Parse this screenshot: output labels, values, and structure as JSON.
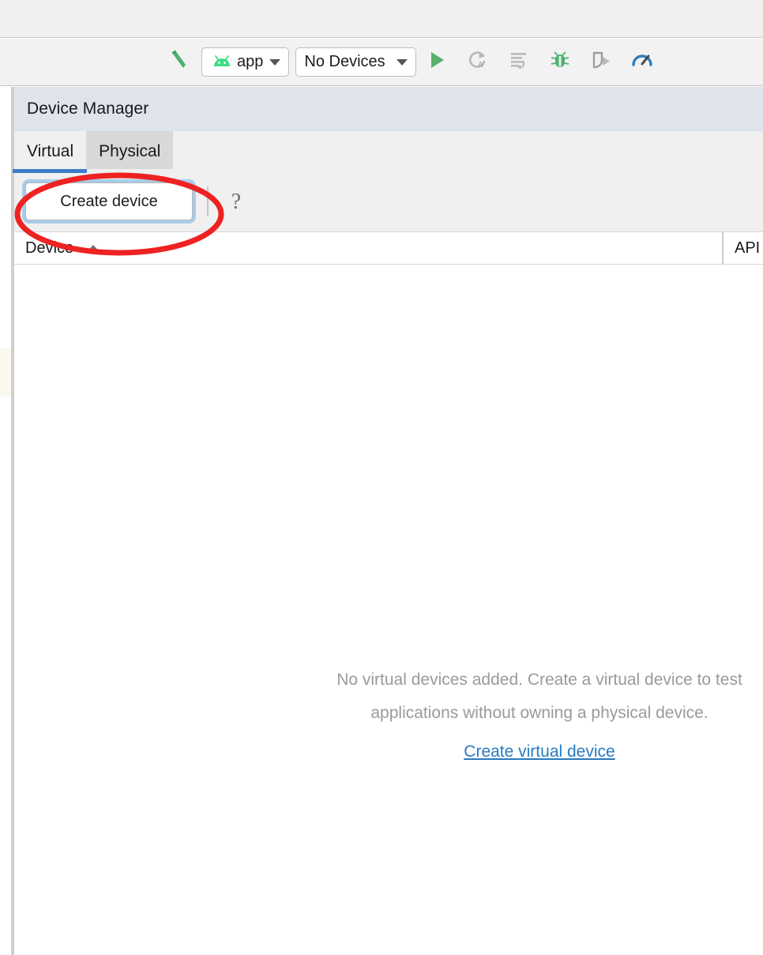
{
  "toolbar": {
    "build_icon": "hammer-build-icon",
    "run_config": {
      "icon": "android-robot-icon",
      "label": "app",
      "caret": "chevron-down-icon"
    },
    "device_selector": {
      "label": "No Devices",
      "caret": "chevron-down-icon"
    },
    "actions": [
      {
        "name": "run-button",
        "icon": "play-triangle-icon",
        "enabled": true
      },
      {
        "name": "apply-changes-button",
        "icon": "apply-changes-icon",
        "enabled": false
      },
      {
        "name": "apply-code-changes-button",
        "icon": "apply-code-changes-icon",
        "enabled": false
      },
      {
        "name": "debug-button",
        "icon": "bug-icon",
        "enabled": true
      },
      {
        "name": "run-with-coverage-button",
        "icon": "shield-run-icon",
        "enabled": false
      },
      {
        "name": "profiler-button",
        "icon": "profiler-gauge-icon",
        "enabled": true
      }
    ]
  },
  "tool_window": {
    "title": "Device Manager",
    "tabs": [
      {
        "label": "Virtual",
        "selected": true
      },
      {
        "label": "Physical",
        "selected": false,
        "hovered": true
      }
    ],
    "actions": {
      "create_device_label": "Create device",
      "help_label": "?"
    }
  },
  "table": {
    "columns": [
      {
        "label": "Device",
        "sorted": "asc",
        "sort_icon": "sort-ascending-arrow"
      },
      {
        "label": "API"
      }
    ],
    "rows": []
  },
  "empty_state": {
    "line1": "No virtual devices added. Create a virtual device to test",
    "line2": "applications without owning a physical device.",
    "link": "Create virtual device"
  },
  "annotation": {
    "type": "ellipse-highlight",
    "color": "#ee2222",
    "target": "create-device-button"
  },
  "colors": {
    "accent_blue": "#3d7cc9",
    "link_blue": "#2a7ac0",
    "android_green": "#3ddc84",
    "annotation_red": "#ee2222",
    "header_bg": "#dfe3ec",
    "toolbar_bg": "#f2f2f2"
  }
}
